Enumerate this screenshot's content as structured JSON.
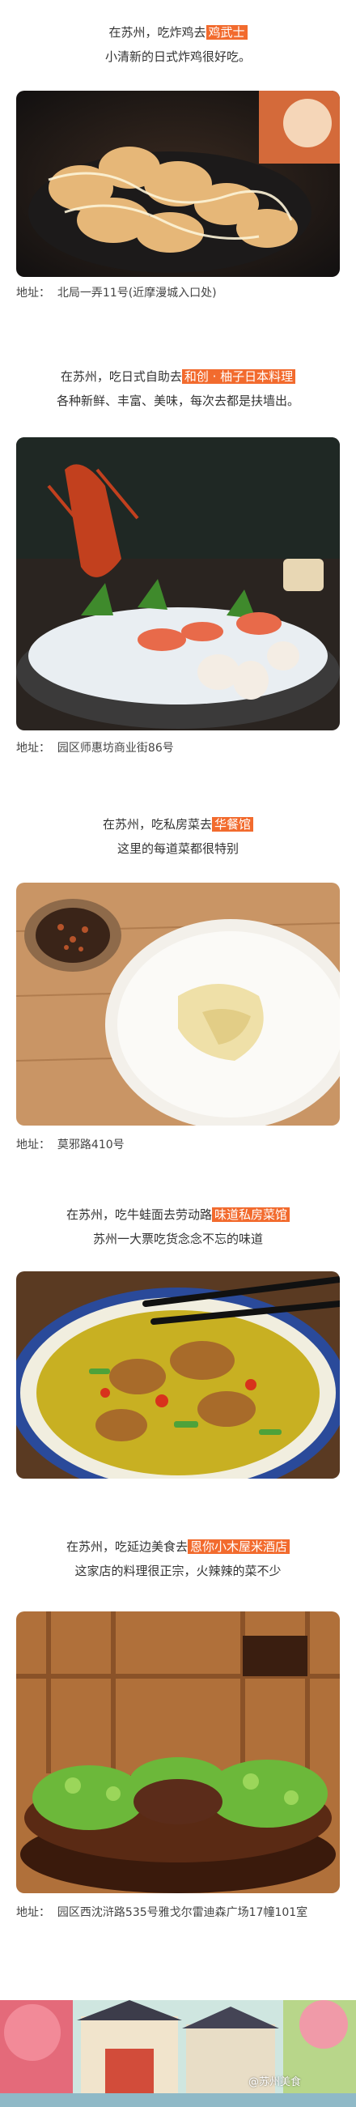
{
  "entries": [
    {
      "headline_prefix": "在苏州，吃炸鸡去",
      "highlight": "鸡武士",
      "subtitle": "小清新的日式炸鸡很好吃。",
      "address_label": "地址：",
      "address": "北局一弄11号(近摩漫城入口处)"
    },
    {
      "headline_prefix": "在苏州，吃日式自助去",
      "highlight": "和创 · 柚子日本料理",
      "subtitle": "各种新鲜、丰富、美味，每次去都是扶墙出。",
      "address_label": "地址：",
      "address": "园区师惠坊商业街86号"
    },
    {
      "headline_prefix": "在苏州，吃私房菜去",
      "highlight": "华餐馆",
      "subtitle": "这里的每道菜都很特别",
      "address_label": "地址：",
      "address": "莫邪路410号"
    },
    {
      "headline_prefix": "在苏州，吃牛蛙面去劳动路",
      "highlight": "味道私房菜馆",
      "subtitle": "苏州一大票吃货念念不忘的味道"
    },
    {
      "headline_prefix": "在苏州，吃延边美食去",
      "highlight": "恩你小木屋米酒店",
      "subtitle": "这家店的料理很正宗，火辣辣的菜不少",
      "address_label": "地址：",
      "address": "园区西沈浒路535号雅戈尔雷迪森广场17幢101室"
    }
  ],
  "watermark": "@苏州美食",
  "colors": {
    "highlight": "#f26b2e"
  }
}
